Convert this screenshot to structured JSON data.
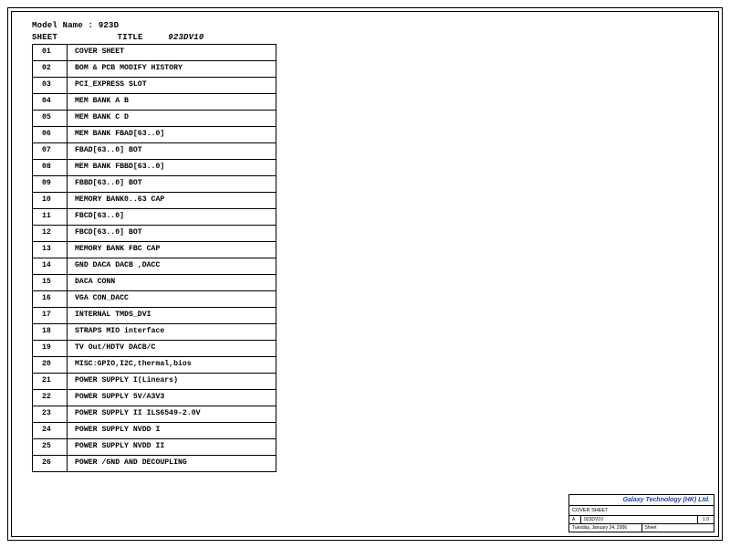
{
  "model_label": "Model Name :",
  "model_value": "923D",
  "header": {
    "sheet_label": "SHEET",
    "title_label": "TITLE",
    "title_value": "923DV10"
  },
  "sheets": [
    {
      "num": "01",
      "title": "COVER SHEET"
    },
    {
      "num": "02",
      "title": "BOM & PCB MODIFY HISTORY"
    },
    {
      "num": "03",
      "title": "PCI_EXPRESS SLOT"
    },
    {
      "num": "04",
      "title": "MEM BANK A B"
    },
    {
      "num": "05",
      "title": "MEM BANK C D"
    },
    {
      "num": "06",
      "title": "MEM BANK FBAD[63..0]"
    },
    {
      "num": "07",
      "title": "FBAD[63..0] BOT"
    },
    {
      "num": "08",
      "title": "MEM BANK FBBD[63..0]"
    },
    {
      "num": "09",
      "title": "FBBD[63..0] BOT"
    },
    {
      "num": "10",
      "title": "MEMORY BANK0..63 CAP"
    },
    {
      "num": "11",
      "title": "FBCD[63..0]"
    },
    {
      "num": "12",
      "title": "FBCD[63..0] BOT"
    },
    {
      "num": "13",
      "title": "MEMORY BANK FBC CAP"
    },
    {
      "num": "14",
      "title": "GND DACA DACB ,DACC"
    },
    {
      "num": "15",
      "title": "DACA CONN"
    },
    {
      "num": "16",
      "title": "VGA CON_DACC"
    },
    {
      "num": "17",
      "title": "INTERNAL TMDS_DVI"
    },
    {
      "num": "18",
      "title": "STRAPS MIO interface"
    },
    {
      "num": "19",
      "title": "TV Out/HDTV DACB/C"
    },
    {
      "num": "20",
      "title": "MISC:GPIO,I2C,thermal,bios"
    },
    {
      "num": "21",
      "title": "POWER SUPPLY I(Linears)"
    },
    {
      "num": "22",
      "title": "POWER SUPPLY 5V/A3V3"
    },
    {
      "num": "23",
      "title": "POWER SUPPLY II ILS6549-2.0V"
    },
    {
      "num": "24",
      "title": "POWER SUPPLY NVDD I"
    },
    {
      "num": "25",
      "title": "POWER SUPPLY NVDD II"
    },
    {
      "num": "26",
      "title": "POWER /GND AND DECOUPLING"
    }
  ],
  "title_block": {
    "company": "Galaxy Technology (HK) Ltd.",
    "doc_title": "COVER SHEET",
    "size": "A",
    "doc_number": "923DV10",
    "rev": "1.0",
    "date": "Tuesday, January 24, 2006",
    "sheet": "Sheet"
  }
}
